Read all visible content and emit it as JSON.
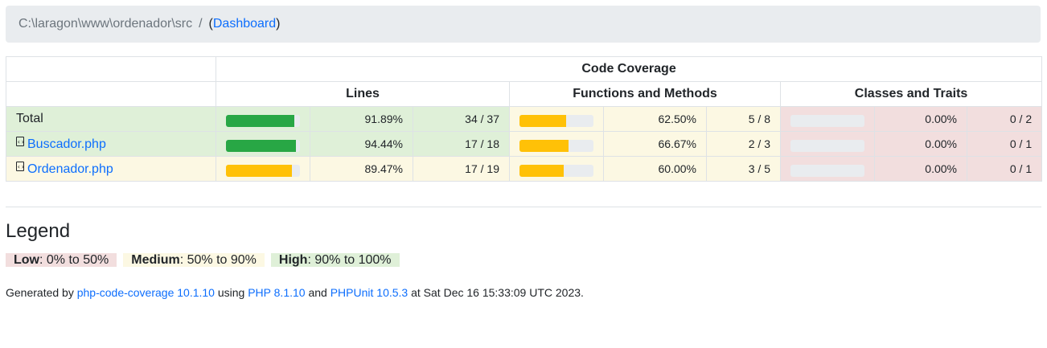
{
  "breadcrumb": {
    "path": "C:\\laragon\\www\\ordenador\\src",
    "separator": "/",
    "open_paren": "(",
    "dashboard_link": "Dashboard",
    "close_paren": ")"
  },
  "table": {
    "header_code_coverage": "Code Coverage",
    "col_lines": "Lines",
    "col_functions": "Functions and Methods",
    "col_classes": "Classes and Traits",
    "rows": [
      {
        "name": "Total",
        "is_file": false,
        "lines": {
          "pct": "91.89%",
          "num": "34 / 37",
          "value": 91.89,
          "level": "high"
        },
        "functions": {
          "pct": "62.50%",
          "num": "5 / 8",
          "value": 62.5,
          "level": "medium"
        },
        "classes": {
          "pct": "0.00%",
          "num": "0 / 2",
          "value": 0,
          "level": "low"
        }
      },
      {
        "name": "Buscador.php",
        "is_file": true,
        "lines": {
          "pct": "94.44%",
          "num": "17 / 18",
          "value": 94.44,
          "level": "high"
        },
        "functions": {
          "pct": "66.67%",
          "num": "2 / 3",
          "value": 66.67,
          "level": "medium"
        },
        "classes": {
          "pct": "0.00%",
          "num": "0 / 1",
          "value": 0,
          "level": "low"
        }
      },
      {
        "name": "Ordenador.php",
        "is_file": true,
        "lines": {
          "pct": "89.47%",
          "num": "17 / 19",
          "value": 89.47,
          "level": "medium"
        },
        "functions": {
          "pct": "60.00%",
          "num": "3 / 5",
          "value": 60,
          "level": "medium"
        },
        "classes": {
          "pct": "0.00%",
          "num": "0 / 1",
          "value": 0,
          "level": "low"
        }
      }
    ]
  },
  "legend": {
    "title": "Legend",
    "low_label": "Low",
    "low_range": ": 0% to 50%",
    "medium_label": "Medium",
    "medium_range": ": 50% to 90%",
    "high_label": "High",
    "high_range": ": 90% to 100%"
  },
  "footer": {
    "generated_by": "Generated by ",
    "tool_link": "php-code-coverage 10.1.10",
    "using": " using ",
    "php_link": "PHP 8.1.10",
    "and": " and ",
    "phpunit_link": "PHPUnit 10.5.3",
    "timestamp": " at Sat Dec 16 15:33:09 UTC 2023."
  },
  "colors": {
    "high": "#28a745",
    "medium": "#ffc107",
    "low": "#dc3545",
    "high_bg": "#dff0d8",
    "medium_bg": "#fcf8e3",
    "low_bg": "#f2dede",
    "link": "#0d6efd"
  },
  "icons": {
    "file": "file-code-icon"
  }
}
